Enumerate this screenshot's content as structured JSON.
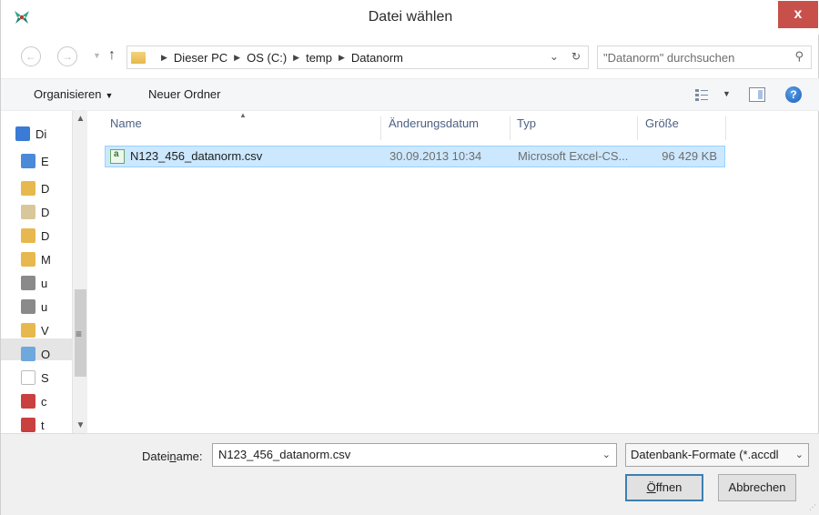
{
  "window": {
    "title": "Datei wählen",
    "close_label": "x"
  },
  "address": {
    "crumbs": [
      "Dieser PC",
      "OS (C:)",
      "temp",
      "Datanorm"
    ],
    "search_placeholder": "\"Datanorm\" durchsuchen"
  },
  "toolbar": {
    "organize_label": "Organisieren",
    "new_folder_label": "Neuer Ordner",
    "help_label": "?"
  },
  "navpane": {
    "items": [
      {
        "label": "Di",
        "icon": "computer-icon",
        "color": "#3a7bd5"
      },
      {
        "label": "E",
        "icon": "desktop-folder-icon",
        "color": "#4a8ad8"
      },
      {
        "label": "D",
        "icon": "documents-folder-icon",
        "color": "#e6b84d"
      },
      {
        "label": "D",
        "icon": "documents-icon",
        "color": "#d8c79a"
      },
      {
        "label": "D",
        "icon": "downloads-folder-icon",
        "color": "#e6b84d"
      },
      {
        "label": "M",
        "icon": "music-folder-icon",
        "color": "#e6b84d"
      },
      {
        "label": "u",
        "icon": "network-folder-icon",
        "color": "#8a8a8a"
      },
      {
        "label": "u",
        "icon": "network-folder-icon",
        "color": "#8a8a8a"
      },
      {
        "label": "V",
        "icon": "videos-folder-icon",
        "color": "#e6b84d"
      },
      {
        "label": "O",
        "icon": "drive-icon",
        "color": "#6fa8dc"
      },
      {
        "label": "S",
        "icon": "file-icon",
        "color": "#ffffff"
      },
      {
        "label": "c",
        "icon": "disconnected-drive-icon",
        "color": "#c94040"
      },
      {
        "label": "t",
        "icon": "disconnected-drive-icon",
        "color": "#c94040"
      }
    ]
  },
  "filelist": {
    "columns": {
      "name": "Name",
      "date": "Änderungsdatum",
      "type": "Typ",
      "size": "Größe"
    },
    "files": [
      {
        "name": "N123_456_datanorm.csv",
        "date": "30.09.2013 10:34",
        "type": "Microsoft Excel-CS...",
        "size": "96 429 KB"
      }
    ]
  },
  "bottom": {
    "filename_label_pre": "Datei",
    "filename_label_u": "n",
    "filename_label_post": "ame:",
    "filename_value": "N123_456_datanorm.csv",
    "filter_value": "Datenbank-Formate (*.accdl",
    "open_pre": "",
    "open_u": "Ö",
    "open_post": "ffnen",
    "cancel_label": "Abbrechen"
  },
  "colors": {
    "selection_fill": "#cce8ff",
    "selection_border": "#99d1ff",
    "close_button": "#c7504b",
    "header_text": "#4d6082"
  }
}
